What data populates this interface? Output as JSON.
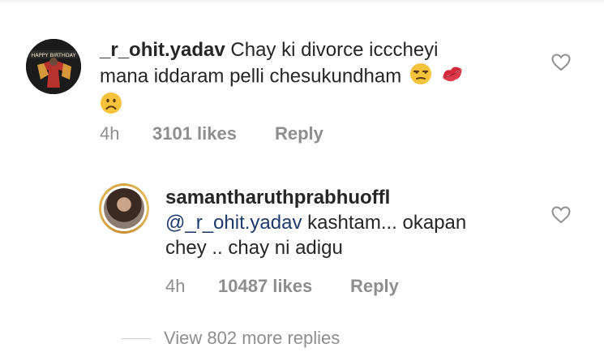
{
  "comments": [
    {
      "username": "_r_ohit.yadav",
      "text_line1": "Chay ki divorce icccheyi",
      "text_line2": "mana iddaram pelli chesukundham",
      "time": "4h",
      "likes": "3101 likes",
      "reply": "Reply",
      "avatar_text": "HAPPY BIRTHDAY"
    },
    {
      "username": "samantharuthprabhuoffl",
      "mention": "@_r_ohit.yadav",
      "text_line1": "kashtam... okapan",
      "text_line2": "chey .. chay ni adigu",
      "time": "4h",
      "likes": "10487 likes",
      "reply": "Reply"
    }
  ],
  "view_more": "View 802 more replies",
  "icons": [
    "unamused-face-emoji",
    "kiss-lips-emoji",
    "frowning-face-emoji",
    "heart-icon"
  ]
}
